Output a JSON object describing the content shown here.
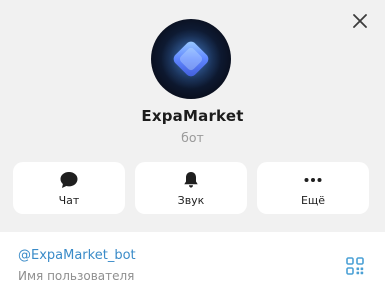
{
  "profile": {
    "name": "ExpaMarket",
    "role": "бот",
    "username": "@ExpaMarket_bot",
    "username_label": "Имя пользователя"
  },
  "actions": [
    {
      "label": "Чат",
      "icon": "chat-bubble-icon"
    },
    {
      "label": "Звук",
      "icon": "bell-icon"
    },
    {
      "label": "Ещё",
      "icon": "more-dots-icon"
    }
  ],
  "icons": {
    "close": "close-icon",
    "qr": "qr-code-icon"
  },
  "colors": {
    "background": "#f1f1f1",
    "card": "#ffffff",
    "link": "#3a8bc8",
    "secondary_text": "#8f8f8f",
    "accent_qr": "#4aa0d5"
  }
}
